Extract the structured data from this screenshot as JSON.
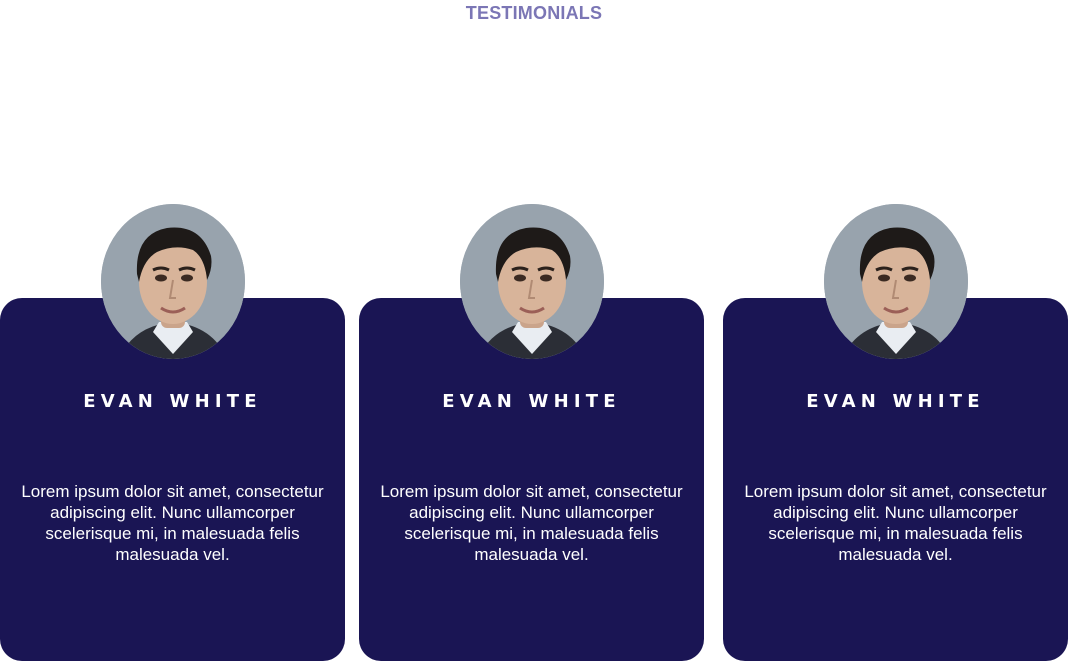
{
  "section": {
    "title": "TESTIMONIALS"
  },
  "testimonials": [
    {
      "name": "EVAN WHITE",
      "quote": "Lorem ipsum dolor sit amet, consectetur adipiscing elit. Nunc ullamcorper scelerisque mi, in malesuada felis malesuada vel.",
      "avatar_icon": "person-portrait"
    },
    {
      "name": "EVAN WHITE",
      "quote": "Lorem ipsum dolor sit amet, consectetur adipiscing elit. Nunc ullamcorper scelerisque mi, in malesuada felis malesuada vel.",
      "avatar_icon": "person-portrait"
    },
    {
      "name": "EVAN WHITE",
      "quote": "Lorem ipsum dolor sit amet, consectetur adipiscing elit. Nunc ullamcorper scelerisque mi, in malesuada felis malesuada vel.",
      "avatar_icon": "person-portrait"
    }
  ],
  "colors": {
    "title": "#7b76b5",
    "card_background": "#1a1554",
    "card_text": "#ffffff"
  }
}
